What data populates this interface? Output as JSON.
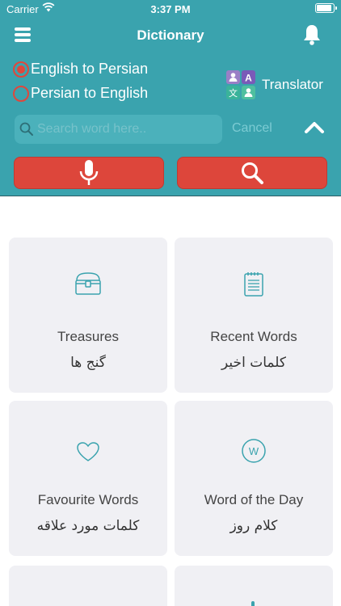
{
  "status_bar": {
    "carrier": "Carrier",
    "time": "3:37 PM"
  },
  "nav": {
    "title": "Dictionary"
  },
  "direction": {
    "options": [
      {
        "label": "English to Persian",
        "selected": true
      },
      {
        "label": "Persian to English",
        "selected": false
      }
    ]
  },
  "translator": {
    "label": "Translator"
  },
  "search": {
    "placeholder": "Search word here..",
    "value": "",
    "cancel_label": "Cancel"
  },
  "colors": {
    "header": "#3aa3ae",
    "accent_red": "#dd463b",
    "icon_teal": "#3aa3ae",
    "tile_bg": "#f0f0f4"
  },
  "tiles": [
    {
      "icon": "treasure-chest-icon",
      "title_en": "Treasures",
      "title_fa": "گنج ها"
    },
    {
      "icon": "notepad-icon",
      "title_en": "Recent Words",
      "title_fa": "کلمات اخیر"
    },
    {
      "icon": "heart-icon",
      "title_en": "Favourite Words",
      "title_fa": "کلمات مورد علاقه"
    },
    {
      "icon": "word-of-day-icon",
      "title_en": "Word of the Day",
      "title_fa": "کلام روز"
    }
  ]
}
